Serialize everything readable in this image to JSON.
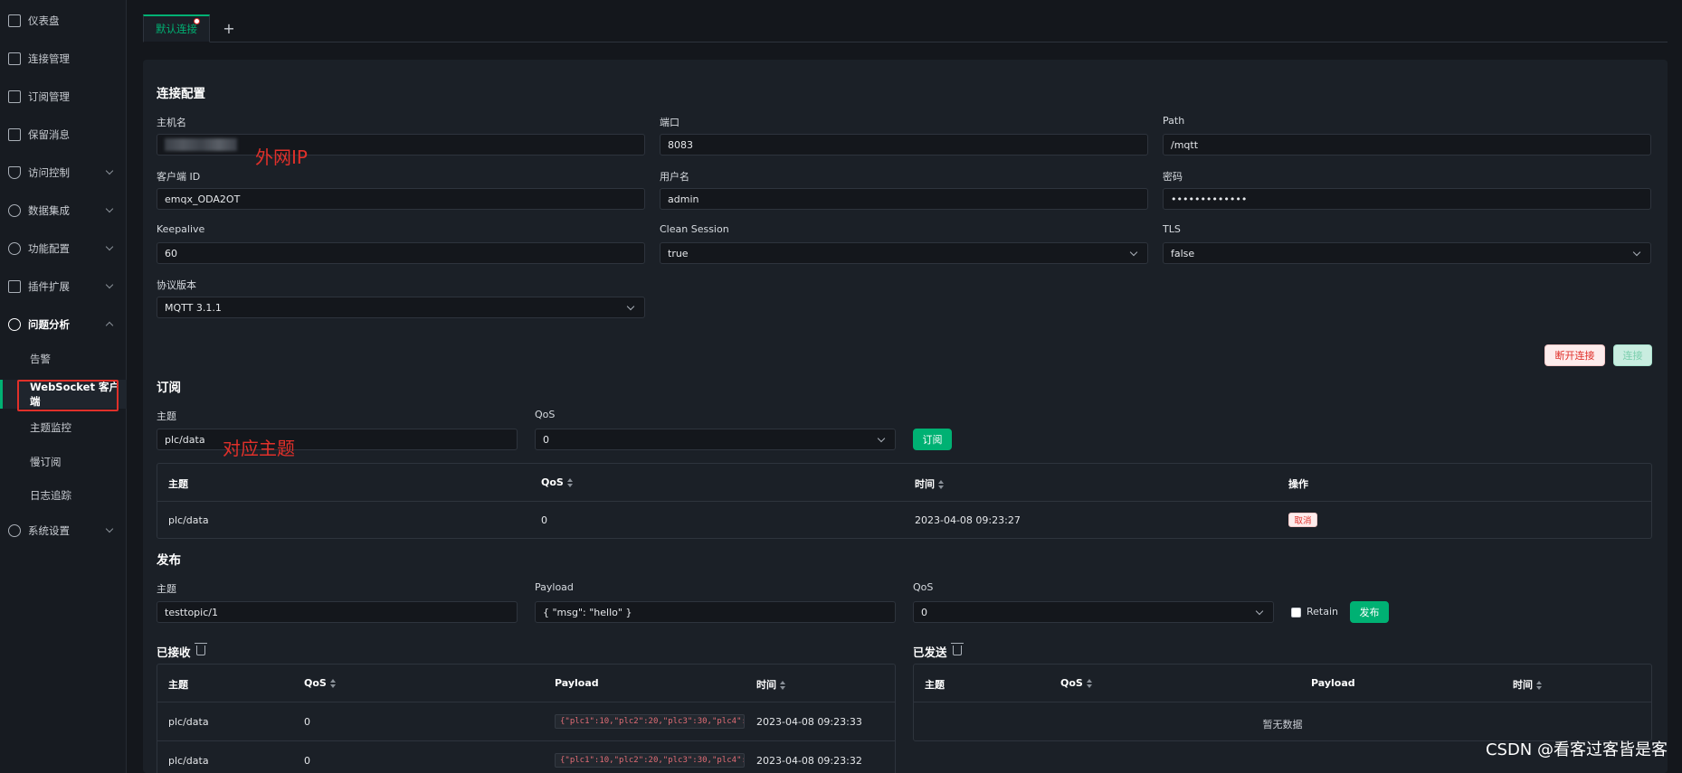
{
  "sidebar": {
    "items": [
      {
        "label": "仪表盘",
        "icon": "dashboard-icon"
      },
      {
        "label": "连接管理",
        "icon": "connections-icon"
      },
      {
        "label": "订阅管理",
        "icon": "subscriptions-icon"
      },
      {
        "label": "保留消息",
        "icon": "retained-icon"
      },
      {
        "label": "访问控制",
        "icon": "shield-icon"
      },
      {
        "label": "数据集成",
        "icon": "integration-icon"
      },
      {
        "label": "功能配置",
        "icon": "settings-icon"
      },
      {
        "label": "插件扩展",
        "icon": "plugin-icon"
      },
      {
        "label": "问题分析",
        "icon": "diagnose-icon"
      },
      {
        "label": "系统设置",
        "icon": "system-icon"
      }
    ],
    "subitems": [
      "告警",
      "WebSocket 客户端",
      "主题监控",
      "慢订阅",
      "日志追踪"
    ]
  },
  "tabs": {
    "active_label": "默认连接",
    "add_label": "+"
  },
  "connection": {
    "title": "连接配置",
    "host_label": "主机名",
    "port_label": "端口",
    "port_value": "8083",
    "path_label": "Path",
    "path_value": "/mqtt",
    "clientid_label": "客户端 ID",
    "clientid_value": "emqx_ODA2OT",
    "username_label": "用户名",
    "username_value": "admin",
    "password_label": "密码",
    "password_value": "•••••••••••••",
    "keepalive_label": "Keepalive",
    "keepalive_value": "60",
    "clean_label": "Clean Session",
    "clean_value": "true",
    "tls_label": "TLS",
    "tls_value": "false",
    "proto_label": "协议版本",
    "proto_value": "MQTT 3.1.1",
    "disconnect_label": "断开连接",
    "connect_label": "连接"
  },
  "annotations": {
    "public_ip": "外网IP",
    "topic": "对应主题"
  },
  "subscribe": {
    "title": "订阅",
    "topic_label": "主题",
    "topic_value": "plc/data",
    "qos_label": "QoS",
    "qos_value": "0",
    "button": "订阅",
    "columns": [
      "主题",
      "QoS",
      "时间",
      "操作"
    ],
    "rows": [
      {
        "topic": "plc/data",
        "qos": "0",
        "time": "2023-04-08 09:23:27",
        "action": "取消"
      }
    ]
  },
  "publish": {
    "title": "发布",
    "topic_label": "主题",
    "topic_value": "testtopic/1",
    "payload_label": "Payload",
    "payload_value": "{ \"msg\": \"hello\" }",
    "qos_label": "QoS",
    "qos_value": "0",
    "retain_label": "Retain",
    "button": "发布"
  },
  "received": {
    "title": "已接收",
    "columns": [
      "主题",
      "QoS",
      "Payload",
      "时间"
    ],
    "rows": [
      {
        "topic": "plc/data",
        "qos": "0",
        "payload": "{\"plc1\":10,\"plc2\":20,\"plc3\":30,\"plc4\":40}",
        "time": "2023-04-08 09:23:33"
      },
      {
        "topic": "plc/data",
        "qos": "0",
        "payload": "{\"plc1\":10,\"plc2\":20,\"plc3\":30,\"plc4\":40}",
        "time": "2023-04-08 09:23:32"
      }
    ]
  },
  "sent": {
    "title": "已发送",
    "columns": [
      "主题",
      "QoS",
      "Payload",
      "时间"
    ],
    "empty": "暂无数据"
  },
  "watermark": "CSDN @看客过客皆是客"
}
